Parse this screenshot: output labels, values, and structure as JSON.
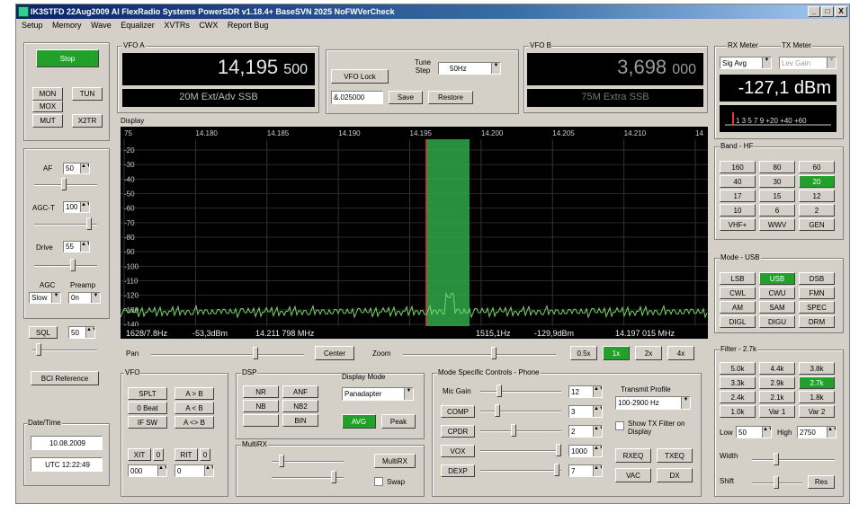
{
  "window": {
    "title": "IK3STFD  22Aug2009  AI FlexRadio Systems PowerSDR  v1.18.4+ BaseSVN 2025 NoFWVerCheck",
    "min": "_",
    "max": "□",
    "close": "X"
  },
  "menu": [
    "Setup",
    "Memory",
    "Wave",
    "Equalizer",
    "XVTRs",
    "CWX",
    "Report Bug"
  ],
  "left": {
    "start": "Stop",
    "mon": "MON",
    "tun": "TUN",
    "mox": "MOX",
    "mut": "MUT",
    "x2tr": "X2TR",
    "af_label": "AF",
    "af_val": "50",
    "agct_label": "AGC-T",
    "agct_val": "100",
    "drive_label": "Drive",
    "drive_val": "55",
    "agc_label": "AGC",
    "agc_val": "Slow",
    "preamp_label": "Preamp",
    "preamp_val": "0n",
    "sql": "SQL",
    "sql_val": "50",
    "bcd_ref": "BCI Reference",
    "datetime_label": "Date/Time",
    "date": "10.08.2009",
    "utc": "UTC 12:22:49"
  },
  "vfoa": {
    "label": "VFO A",
    "freq_main": "14,195",
    "freq_small": "500",
    "band_desc": "20M Ext/Adv SSB"
  },
  "vfo_mid": {
    "vfo_lock": "VFO Lock",
    "tune_step_label": "Tune Step",
    "tune_step_val": "50Hz",
    "mem_val": "&.025000",
    "save": "Save",
    "restore": "Restore"
  },
  "vfob": {
    "label": "VFO B",
    "freq_main": "3,698",
    "freq_small": "000",
    "band_desc": "75M Extra SSB"
  },
  "meters": {
    "rx_label": "RX Meter",
    "tx_label": "TX Meter",
    "rx_sel": "Sig Avg",
    "tx_sel": "Lev Gain",
    "reading": "-127,1 dBm",
    "scale": "1 3 5 7 9 +20 +40 +60"
  },
  "display": {
    "label": "Display",
    "freq_ticks": [
      "75",
      "14.180",
      "14.185",
      "14.190",
      "14.195",
      "14.200",
      "14.205",
      "14.210",
      "14"
    ],
    "db_ticks": [
      "-20",
      "-30",
      "-40",
      "-50",
      "-60",
      "-70",
      "-80",
      "-90",
      "-100",
      "-110",
      "-120",
      "-130",
      "-140"
    ],
    "status_left": "1628/7.8Hz",
    "status_dbm": "-53,3dBm",
    "status_freq": "14.211 798 MHz",
    "status_right_hz": "1515,1Hz",
    "status_right_dbm": "-129,9dBm",
    "status_right_freq": "14.197 015 MHz"
  },
  "pan": {
    "pan_label": "Pan",
    "center": "Center",
    "zoom_label": "Zoom",
    "z05": "0.5x",
    "z1": "1x",
    "z2": "2x",
    "z4": "4x"
  },
  "vfo_panel": {
    "label": "VFO",
    "split": "SPLT",
    "ab": "A > B",
    "ab2": "A < B",
    "0beat": "0 Beat",
    "ifsw": "IF SW",
    "swap": "A <> B",
    "xit": "XIT",
    "rit": "RIT",
    "c": "0",
    "xit_val": "000",
    "rit_val": "0"
  },
  "dsp": {
    "label": "DSP",
    "nr": "NR",
    "anf": "ANF",
    "nb": "NB",
    "nb2": "NB2",
    "bin": "BIN",
    "mode_label": "Display Mode",
    "mode_val": "Panadapter",
    "avg": "AVG",
    "peak": "Peak"
  },
  "multirx": {
    "label": "MultiRX",
    "btn": "MultiRX",
    "swap": "Swap"
  },
  "msc": {
    "label": "Mode Specific Controls - Phone",
    "mic": "Mic Gain",
    "mic_val": "12",
    "comp": "COMP",
    "comp_val": "3",
    "cpdr": "CPDR",
    "cpdr_val": "2",
    "vox": "VOX",
    "vox_val": "1000",
    "dexp": "DEXP",
    "dexp_val": "7",
    "tx_profile_label": "Transmit Profile",
    "tx_profile": "100-2900 Hz",
    "show_filter": "Show TX Filter on Display",
    "txeq": "TXEQ",
    "rxeq": "RXEQ",
    "vac": "VAC",
    "dx": "DX"
  },
  "band": {
    "label": "Band - HF",
    "items": [
      "160",
      "80",
      "60",
      "40",
      "30",
      "20",
      "17",
      "15",
      "12",
      "10",
      "6",
      "2",
      "VHF+",
      "WWV",
      "GEN"
    ],
    "active": "20"
  },
  "mode": {
    "label": "Mode - USB",
    "items": [
      "LSB",
      "USB",
      "DSB",
      "CWL",
      "CWU",
      "FMN",
      "AM",
      "SAM",
      "SPEC",
      "DIGL",
      "DIGU",
      "DRM"
    ],
    "active": "USB"
  },
  "filter": {
    "label": "Filter - 2.7k",
    "items": [
      "5.0k",
      "4.4k",
      "3.8k",
      "3.3k",
      "2.9k",
      "2.7k",
      "2.4k",
      "2.1k",
      "1.8k",
      "1.0k",
      "Var 1",
      "Var 2"
    ],
    "active": "2.7k",
    "low_label": "Low",
    "low_val": "50",
    "high_label": "High",
    "high_val": "2750",
    "width_label": "Width",
    "shift_label": "Shift",
    "reset": "Res"
  },
  "colors": {
    "green": "#22a12a",
    "passband": "#2fa84a",
    "trace": "#7ad36a"
  }
}
